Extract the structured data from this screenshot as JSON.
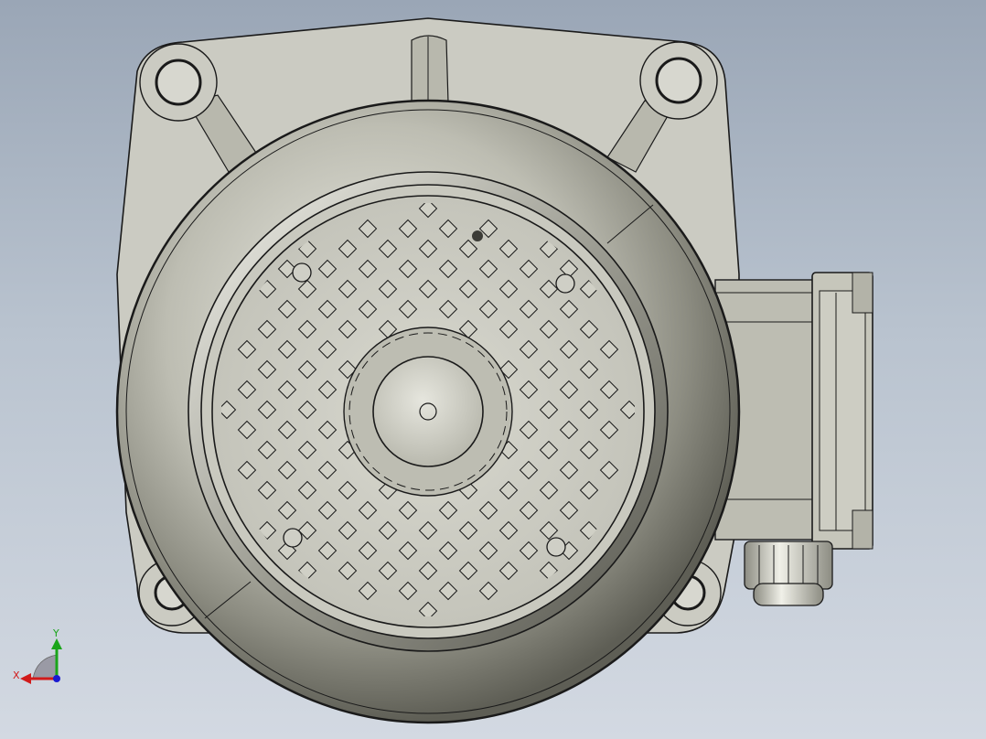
{
  "viewport": {
    "background_top": "#9aa6b6",
    "background_bottom": "#d3d9e2"
  },
  "model": {
    "body_color": "#c8c8bc",
    "housing_color": "#cfcfc6",
    "edge_color": "#1a1a1a",
    "junction_box_color": "#c2c2b8"
  },
  "triad": {
    "x_label": "X",
    "y_label": "Y",
    "x_color": "#d11a1a",
    "y_color": "#1aa51a",
    "z_color": "#1a1ad1"
  }
}
